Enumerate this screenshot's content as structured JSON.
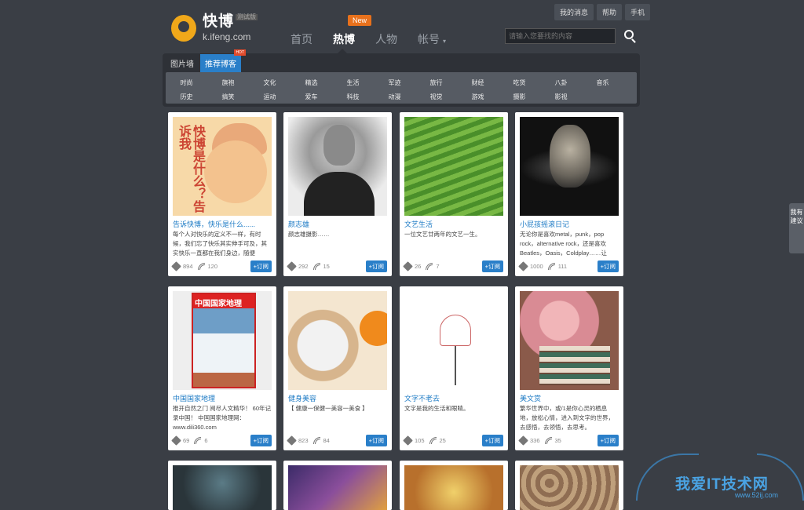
{
  "logo": {
    "name": "快博",
    "beta": "测试版",
    "url": "k.ifeng.com"
  },
  "top_links": [
    "我的消息",
    "帮助",
    "手机"
  ],
  "nav": {
    "items": [
      {
        "label": "首页",
        "active": false
      },
      {
        "label": "热博",
        "active": true
      },
      {
        "label": "人物",
        "active": false
      },
      {
        "label": "帐号",
        "active": false
      }
    ],
    "new_badge": "New",
    "account_caret": "▾"
  },
  "search": {
    "placeholder": "请输入您要找的内容"
  },
  "panel": {
    "tabs": [
      {
        "label": "图片墙",
        "active": false
      },
      {
        "label": "推荐博客",
        "active": true
      }
    ],
    "hot_tag": "HOT",
    "categories_row1": [
      "时尚",
      "旗袍",
      "文化",
      "精选",
      "生活",
      "军迹",
      "旅行",
      "财经",
      "吃货",
      "八卦",
      "音乐"
    ],
    "categories_row2": [
      "历史",
      "搞笑",
      "运动",
      "爱车",
      "科技",
      "动漫",
      "视觉",
      "游戏",
      "摄影",
      "影视"
    ]
  },
  "subscribe_label": "+订阅",
  "cards": [
    {
      "title": "告诉快博，快乐是什么......",
      "desc": "每个人对快乐的定义不一样，有时候，我们忘了快乐其实伸手可及，其实快乐一直都在我们身边，随便",
      "pins": "894",
      "subs": "120",
      "art_text": "快博是什么？告诉我"
    },
    {
      "title": "颜志雄",
      "desc": "颜志雄摄影……",
      "pins": "292",
      "subs": "15"
    },
    {
      "title": "文艺生活",
      "desc": "一位文艺廿两年的文艺一生。",
      "pins": "26",
      "subs": "7"
    },
    {
      "title": "小屁孩摇滚日记",
      "desc": "无论你是喜欢metal，punk，pop rock，alternative rock，还是喜欢Beatles，Oasis，Coldplay……让",
      "pins": "1000",
      "subs": "111"
    },
    {
      "title": "中国国家地理",
      "desc": "推开自然之门 阅尽人文精华！ 60年记录中国！ 中国国家地理网：www.dili360.com",
      "pins": "69",
      "subs": "6",
      "art_text": "中国国家地理"
    },
    {
      "title": "健身美容",
      "desc": "【 健康一保健一美容一美食 】",
      "pins": "823",
      "subs": "84"
    },
    {
      "title": "文字不老去",
      "desc": "文字是我的生活和眼睛。",
      "pins": "105",
      "subs": "25"
    },
    {
      "title": "美文赏",
      "desc": "繁华世界中，或/1是你心灵的栖息地，放松心情，进入到文字的世界，去感悟，去领悟，去思考。",
      "pins": "336",
      "subs": "35"
    }
  ],
  "feedback": "我有建议",
  "watermark": {
    "text": "我爱IT技术网",
    "url": "www.52ij.com"
  }
}
